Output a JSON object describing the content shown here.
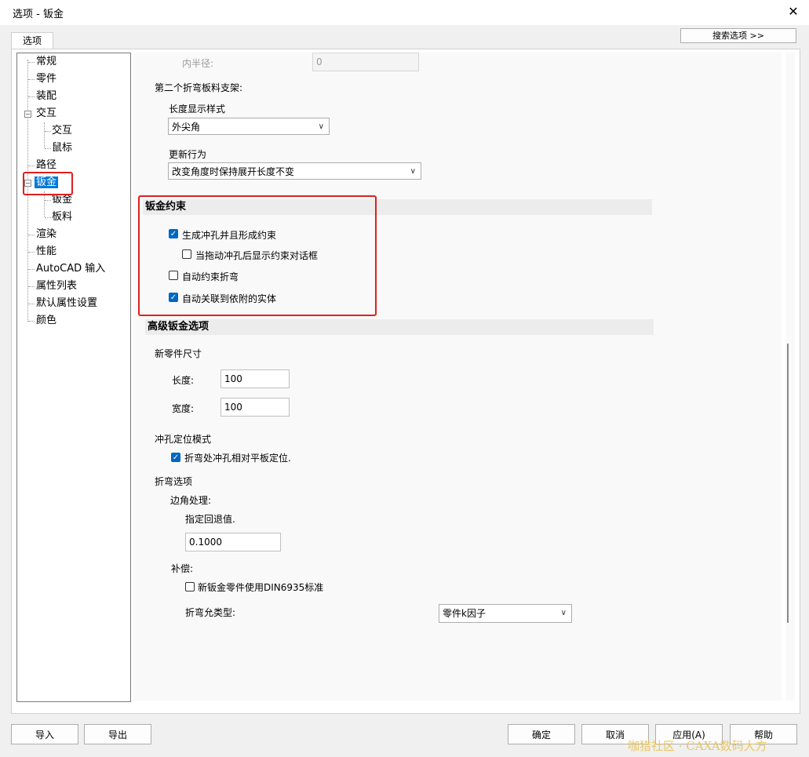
{
  "window": {
    "title": "选项 - 钣金",
    "close": "✕"
  },
  "tab": "选项",
  "search_button": "搜索选项 >>",
  "tree": {
    "items": [
      "常规",
      "零件",
      "装配",
      "交互",
      "交互",
      "鼠标",
      "路径",
      "钣金",
      "钣金",
      "板料",
      "渲染",
      "性能",
      "AutoCAD 输入",
      "属性列表",
      "默认属性设置",
      "颜色"
    ],
    "expander": "−"
  },
  "content": {
    "inner_radius_label": "内半径:",
    "inner_radius_value": "0",
    "second_bend_label": "第二个折弯板料支架:",
    "length_style_label": "长度显示样式",
    "length_style_value": "外尖角",
    "update_label": "更新行为",
    "update_value": "改变角度时保持展开长度不变",
    "constraint_section": "钣金约束",
    "cb1": "生成冲孔并且形成约束",
    "cb2": "当拖动冲孔后显示约束对话框",
    "cb3": "自动约束折弯",
    "cb4": "自动关联到依附的实体",
    "advanced_section": "高级钣金选项",
    "new_part_size": "新零件尺寸",
    "length_label": "长度:",
    "length_value": "100",
    "width_label": "宽度:",
    "width_value": "100",
    "punch_mode": "冲孔定位模式",
    "cb5": "折弯处冲孔相对平板定位.",
    "bend_options": "折弯选项",
    "corner_label": "边角处理:",
    "retract_label": "指定回退值.",
    "retract_value": "0.1000",
    "compensation_label": "补偿:",
    "cb6": "新钣金零件使用DIN6935标准",
    "bend_type_label": "折弯允类型:",
    "bend_type_value": "零件k因子"
  },
  "buttons": {
    "import": "导入",
    "export": "导出",
    "ok": "确定",
    "cancel": "取消",
    "apply": "应用(A)",
    "help": "帮助"
  },
  "watermark": "咖猎社区 · CAXA数码大方",
  "colors": {
    "highlight": "#e02020",
    "selected": "#0078d7",
    "checkbox": "#0067c0"
  }
}
